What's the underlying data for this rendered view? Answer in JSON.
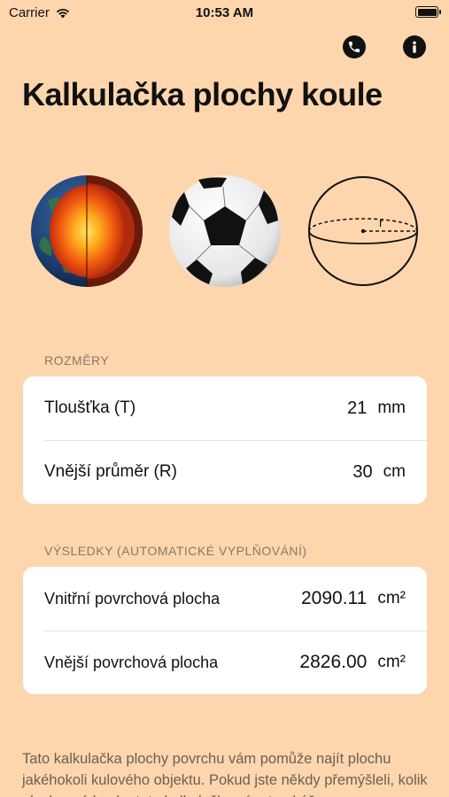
{
  "status_bar": {
    "carrier": "Carrier",
    "time": "10:53 AM"
  },
  "header": {
    "title": "Kalkulačka plochy koule",
    "phone_icon": "phone-icon",
    "info_icon": "info-icon"
  },
  "images": [
    {
      "name": "earth-core-image"
    },
    {
      "name": "soccer-ball-image"
    },
    {
      "name": "sphere-diagram-image",
      "label": "r"
    }
  ],
  "dimensions": {
    "section_label": "ROZMĚRY",
    "rows": [
      {
        "label": "Tloušťka (T)",
        "value": "21",
        "unit": "mm"
      },
      {
        "label": "Vnější průměr (R)",
        "value": "30",
        "unit": "cm"
      }
    ]
  },
  "results": {
    "section_label": "VÝSLEDKY (AUTOMATICKÉ VYPLŇOVÁNÍ)",
    "rows": [
      {
        "label": "Vnitřní povrchová plocha",
        "value": "2090.11",
        "unit": "cm²"
      },
      {
        "label": "Vnější povrchová plocha",
        "value": "2826.00",
        "unit": "cm²"
      }
    ]
  },
  "description": "Tato kalkulačka plochy povrchu vám pomůže najít plochu jakéhokoli kulového objektu. Pokud jste někdy přemýšleli, kolik plochy má koule, tato kalkulačka vám to ukáže."
}
